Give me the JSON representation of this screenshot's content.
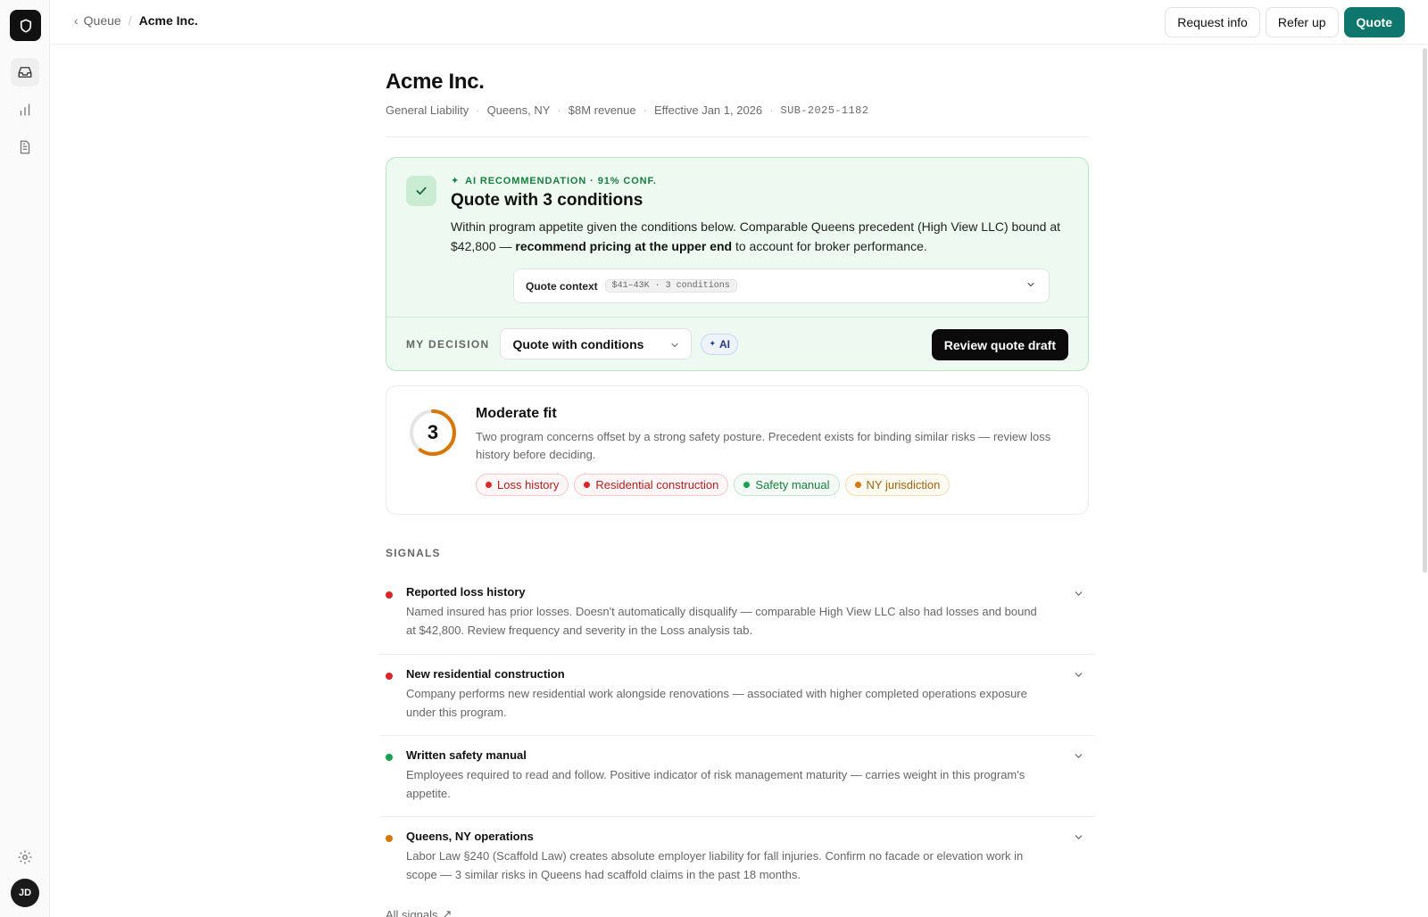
{
  "breadcrumb": {
    "parent": "Queue",
    "current": "Acme Inc."
  },
  "actions": {
    "request_info": "Request info",
    "refer_up": "Refer up",
    "quote": "Quote"
  },
  "header": {
    "title": "Acme Inc.",
    "meta": [
      "General Liability",
      "Queens, NY",
      "$8M revenue",
      "Effective Jan 1, 2026",
      "SUB-2025-1182"
    ]
  },
  "recommendation": {
    "label": "AI RECOMMENDATION · 91% CONF.",
    "title": "Quote with 3 conditions",
    "text_before": "Within program appetite given the conditions below. Comparable Queens precedent (High View LLC) bound at $42,800 — ",
    "text_bold": "recommend pricing at the upper end",
    "text_after": " to account for broker performance.",
    "context_label": "Quote context",
    "context_badge": "$41–43K · 3 conditions",
    "decision_label": "MY DECISION",
    "decision_value": "Quote with conditions",
    "ai_chip": "AI",
    "review_button": "Review quote draft"
  },
  "fit": {
    "score": "3",
    "score_level": 0.6,
    "title": "Moderate fit",
    "text": "Two program concerns offset by a strong safety posture. Precedent exists for binding similar risks — review loss history before deciding.",
    "tags": [
      "Loss history",
      "Residential construction",
      "Safety manual",
      "NY jurisdiction"
    ]
  },
  "signals": {
    "heading": "SIGNALS",
    "items": [
      {
        "title": "Reported loss history",
        "text": "Named insured has prior losses. Doesn't automatically disqualify — comparable High View LLC also had losses and bound at $42,800. Review frequency and severity in the Loss analysis tab."
      },
      {
        "title": "New residential construction",
        "text": "Company performs new residential work alongside renovations — associated with higher completed operations exposure under this program."
      },
      {
        "title": "Written safety manual",
        "text": "Employees required to read and follow. Positive indicator of risk management maturity — carries weight in this program's appetite."
      },
      {
        "title": "Queens, NY operations",
        "text": "Labor Law §240 (Scaffold Law) creates absolute employer liability for fall injuries. Confirm no facade or elevation work in scope — 3 similar risks in Queens had scaffold claims in the past 18 months."
      }
    ],
    "all_link": "All signals"
  },
  "user": {
    "initials": "JD"
  },
  "colors": {
    "accent": "#0f766e",
    "negative": "#dc2626",
    "positive": "#16a34a",
    "caution": "#d97706"
  }
}
